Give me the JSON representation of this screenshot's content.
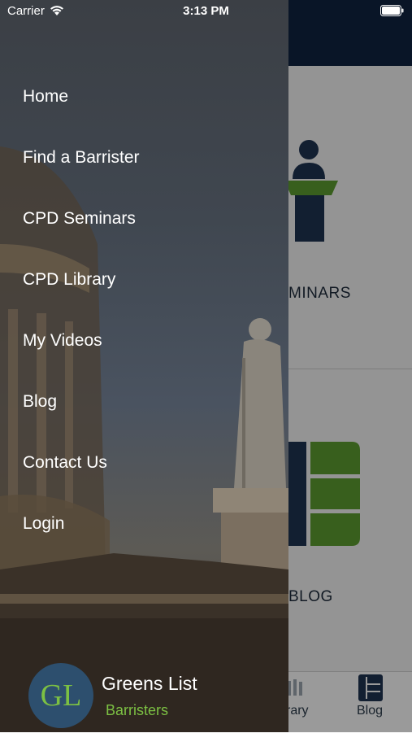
{
  "status_bar": {
    "carrier": "Carrier",
    "time": "3:13 PM"
  },
  "drawer": {
    "menu": [
      {
        "label": "Home"
      },
      {
        "label": "Find a Barrister"
      },
      {
        "label": "CPD Seminars"
      },
      {
        "label": "CPD Library"
      },
      {
        "label": "My Videos"
      },
      {
        "label": "Blog"
      },
      {
        "label": "Contact Us"
      },
      {
        "label": "Login"
      }
    ],
    "brand": {
      "logo_text": "GL",
      "name": "Greens List",
      "subtitle": "Barristers"
    }
  },
  "background_app": {
    "tiles": [
      {
        "label": "MINARS",
        "icon": "lectern-icon"
      },
      {
        "label": "BLOG",
        "icon": "blog-icon"
      }
    ],
    "tabbar": [
      {
        "label": "rary"
      },
      {
        "label": "Blog",
        "icon": "blog-tab-icon"
      }
    ]
  },
  "colors": {
    "nav_bar": "#0f2340",
    "accent_green": "#7cc043",
    "logo_circle": "#2d4f6e",
    "icon_navy": "#1e3350"
  }
}
